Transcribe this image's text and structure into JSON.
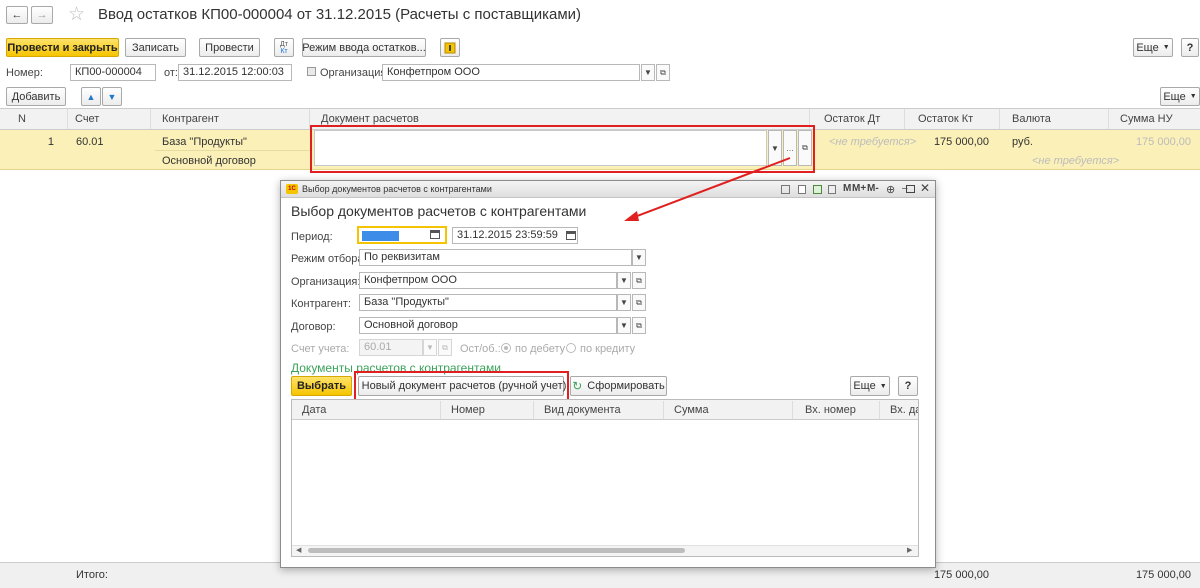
{
  "header": {
    "title": "Ввод остатков КП00-000004 от 31.12.2015 (Расчеты с поставщиками)",
    "back_icon": "←",
    "forward_icon": "→",
    "star_icon": "☆"
  },
  "toolbar": {
    "post_close": "Провести и закрыть",
    "save": "Записать",
    "post": "Провести",
    "dtkt_top": "Дт",
    "dtkt_bottom": "Кт",
    "mode": "Режим ввода остатков...",
    "more": "Еще",
    "help": "?"
  },
  "form": {
    "number_label": "Номер:",
    "number_value": "КП00-000004",
    "date_label": "от:",
    "date_value": "31.12.2015 12:00:03",
    "org_label": "Организация:",
    "org_value": "Конфетпром ООО"
  },
  "table_toolbar": {
    "add": "Добавить",
    "more": "Еще"
  },
  "table": {
    "headers": [
      "N",
      "Счет",
      "Контрагент",
      "Документ расчетов",
      "Остаток Дт",
      "Остаток Кт",
      "Валюта",
      "Сумма НУ"
    ],
    "row": {
      "n": "1",
      "account": "60.01",
      "contractor": "База \"Продукты\"",
      "contract": "Основной договор",
      "balance_dt": "<не требуется>",
      "balance_kt": "175 000,00",
      "currency": "руб.",
      "currency_sum": "<не требуется>",
      "sum_nu": "175 000,00"
    },
    "footer": {
      "total_label": "Итого:",
      "total_kt": "175 000,00",
      "total_nu": "175 000,00"
    }
  },
  "dialog": {
    "window_title": "Выбор документов расчетов с контрагентами",
    "heading": "Выбор документов расчетов с контрагентами",
    "period_label": "Период:",
    "period_from": "",
    "period_to": "31.12.2015 23:59:59",
    "mode_label": "Режим отбора:",
    "mode_value": "По реквизитам",
    "org_label": "Организация:",
    "org_value": "Конфетпром ООО",
    "contractor_label": "Контрагент:",
    "contractor_value": "База \"Продукты\"",
    "contract_label": "Договор:",
    "contract_value": "Основной договор",
    "account_label": "Счет учета:",
    "account_value": "60.01",
    "side_label": "Ост/об.:",
    "debit": "по дебету",
    "credit": "по кредиту",
    "section": "Документы расчетов с контрагентами",
    "select": "Выбрать",
    "new_doc": "Новый документ расчетов (ручной учет)",
    "generate": "Сформировать",
    "more": "Еще",
    "help": "?",
    "columns": [
      "Дата",
      "Номер",
      "Вид документа",
      "Сумма",
      "Вх. номер",
      "Вх. дата"
    ],
    "window_buttons": [
      "M",
      "M+",
      "M-"
    ]
  },
  "colors": {
    "accent_yellow": "#f5c400",
    "selected_row": "#faf0b8",
    "annotation_red": "#e02020",
    "green": "#3aa35a"
  }
}
